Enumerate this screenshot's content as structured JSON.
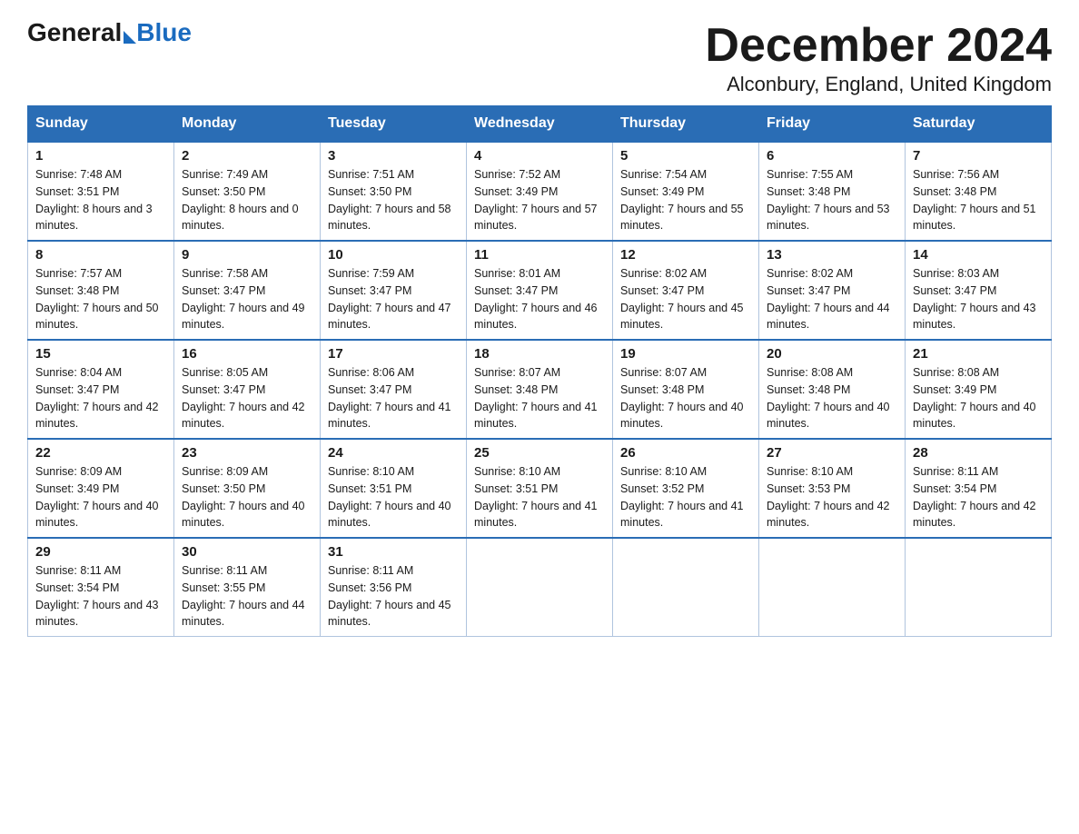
{
  "header": {
    "logo": {
      "general": "General",
      "blue": "Blue"
    },
    "title": "December 2024",
    "location": "Alconbury, England, United Kingdom"
  },
  "days_of_week": [
    "Sunday",
    "Monday",
    "Tuesday",
    "Wednesday",
    "Thursday",
    "Friday",
    "Saturday"
  ],
  "weeks": [
    [
      {
        "day": "1",
        "sunrise": "7:48 AM",
        "sunset": "3:51 PM",
        "daylight": "8 hours and 3 minutes."
      },
      {
        "day": "2",
        "sunrise": "7:49 AM",
        "sunset": "3:50 PM",
        "daylight": "8 hours and 0 minutes."
      },
      {
        "day": "3",
        "sunrise": "7:51 AM",
        "sunset": "3:50 PM",
        "daylight": "7 hours and 58 minutes."
      },
      {
        "day": "4",
        "sunrise": "7:52 AM",
        "sunset": "3:49 PM",
        "daylight": "7 hours and 57 minutes."
      },
      {
        "day": "5",
        "sunrise": "7:54 AM",
        "sunset": "3:49 PM",
        "daylight": "7 hours and 55 minutes."
      },
      {
        "day": "6",
        "sunrise": "7:55 AM",
        "sunset": "3:48 PM",
        "daylight": "7 hours and 53 minutes."
      },
      {
        "day": "7",
        "sunrise": "7:56 AM",
        "sunset": "3:48 PM",
        "daylight": "7 hours and 51 minutes."
      }
    ],
    [
      {
        "day": "8",
        "sunrise": "7:57 AM",
        "sunset": "3:48 PM",
        "daylight": "7 hours and 50 minutes."
      },
      {
        "day": "9",
        "sunrise": "7:58 AM",
        "sunset": "3:47 PM",
        "daylight": "7 hours and 49 minutes."
      },
      {
        "day": "10",
        "sunrise": "7:59 AM",
        "sunset": "3:47 PM",
        "daylight": "7 hours and 47 minutes."
      },
      {
        "day": "11",
        "sunrise": "8:01 AM",
        "sunset": "3:47 PM",
        "daylight": "7 hours and 46 minutes."
      },
      {
        "day": "12",
        "sunrise": "8:02 AM",
        "sunset": "3:47 PM",
        "daylight": "7 hours and 45 minutes."
      },
      {
        "day": "13",
        "sunrise": "8:02 AM",
        "sunset": "3:47 PM",
        "daylight": "7 hours and 44 minutes."
      },
      {
        "day": "14",
        "sunrise": "8:03 AM",
        "sunset": "3:47 PM",
        "daylight": "7 hours and 43 minutes."
      }
    ],
    [
      {
        "day": "15",
        "sunrise": "8:04 AM",
        "sunset": "3:47 PM",
        "daylight": "7 hours and 42 minutes."
      },
      {
        "day": "16",
        "sunrise": "8:05 AM",
        "sunset": "3:47 PM",
        "daylight": "7 hours and 42 minutes."
      },
      {
        "day": "17",
        "sunrise": "8:06 AM",
        "sunset": "3:47 PM",
        "daylight": "7 hours and 41 minutes."
      },
      {
        "day": "18",
        "sunrise": "8:07 AM",
        "sunset": "3:48 PM",
        "daylight": "7 hours and 41 minutes."
      },
      {
        "day": "19",
        "sunrise": "8:07 AM",
        "sunset": "3:48 PM",
        "daylight": "7 hours and 40 minutes."
      },
      {
        "day": "20",
        "sunrise": "8:08 AM",
        "sunset": "3:48 PM",
        "daylight": "7 hours and 40 minutes."
      },
      {
        "day": "21",
        "sunrise": "8:08 AM",
        "sunset": "3:49 PM",
        "daylight": "7 hours and 40 minutes."
      }
    ],
    [
      {
        "day": "22",
        "sunrise": "8:09 AM",
        "sunset": "3:49 PM",
        "daylight": "7 hours and 40 minutes."
      },
      {
        "day": "23",
        "sunrise": "8:09 AM",
        "sunset": "3:50 PM",
        "daylight": "7 hours and 40 minutes."
      },
      {
        "day": "24",
        "sunrise": "8:10 AM",
        "sunset": "3:51 PM",
        "daylight": "7 hours and 40 minutes."
      },
      {
        "day": "25",
        "sunrise": "8:10 AM",
        "sunset": "3:51 PM",
        "daylight": "7 hours and 41 minutes."
      },
      {
        "day": "26",
        "sunrise": "8:10 AM",
        "sunset": "3:52 PM",
        "daylight": "7 hours and 41 minutes."
      },
      {
        "day": "27",
        "sunrise": "8:10 AM",
        "sunset": "3:53 PM",
        "daylight": "7 hours and 42 minutes."
      },
      {
        "day": "28",
        "sunrise": "8:11 AM",
        "sunset": "3:54 PM",
        "daylight": "7 hours and 42 minutes."
      }
    ],
    [
      {
        "day": "29",
        "sunrise": "8:11 AM",
        "sunset": "3:54 PM",
        "daylight": "7 hours and 43 minutes."
      },
      {
        "day": "30",
        "sunrise": "8:11 AM",
        "sunset": "3:55 PM",
        "daylight": "7 hours and 44 minutes."
      },
      {
        "day": "31",
        "sunrise": "8:11 AM",
        "sunset": "3:56 PM",
        "daylight": "7 hours and 45 minutes."
      },
      null,
      null,
      null,
      null
    ]
  ]
}
